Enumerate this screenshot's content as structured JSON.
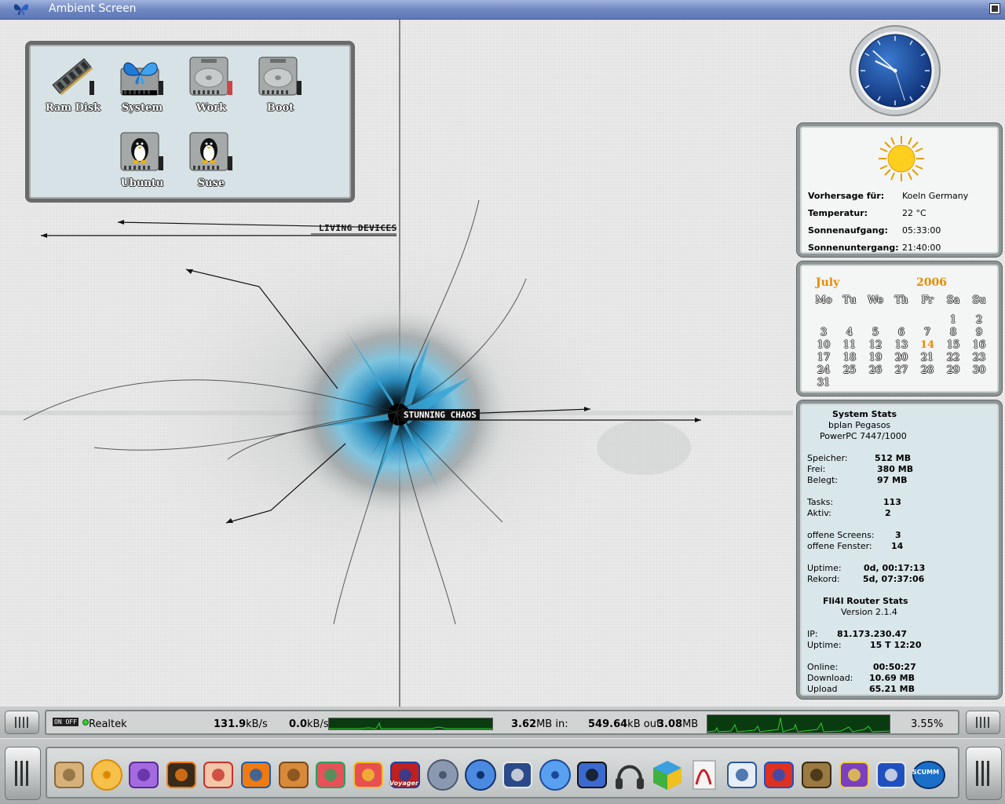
{
  "window": {
    "title": "Ambient Screen"
  },
  "drives": [
    {
      "label": "Ram Disk",
      "icon": "ram-disk-icon"
    },
    {
      "label": "System",
      "icon": "system-drive-icon"
    },
    {
      "label": "Work",
      "icon": "work-drive-icon"
    },
    {
      "label": "Boot",
      "icon": "boot-drive-icon"
    },
    {
      "label": "Ubuntu",
      "icon": "ubuntu-drive-icon"
    },
    {
      "label": "Suse",
      "icon": "suse-drive-icon"
    }
  ],
  "art": {
    "label_top": "LIVING DEVICES",
    "label_center": "STUNNING CHAOS"
  },
  "clock": {
    "hours": 9,
    "minutes": 52,
    "seconds": 27
  },
  "weather": {
    "icon": "sun-icon",
    "rows": [
      {
        "label": "Vorhersage für:",
        "value": "Koeln Germany"
      },
      {
        "label": "Temperatur:",
        "value": "22 °C"
      },
      {
        "label": "Sonnenaufgang:",
        "value": "05:33:00"
      },
      {
        "label": "Sonnenuntergang:",
        "value": "21:40:00"
      }
    ]
  },
  "calendar": {
    "month": "July",
    "year": "2006",
    "weekdays": [
      "Mo",
      "Tu",
      "We",
      "Th",
      "Fr",
      "Sa",
      "Su"
    ],
    "days": [
      "1",
      "2",
      "3",
      "4",
      "5",
      "6",
      "7",
      "8",
      "9",
      "10",
      "11",
      "12",
      "13",
      "14",
      "15",
      "16",
      "17",
      "18",
      "19",
      "20",
      "21",
      "22",
      "23",
      "24",
      "25",
      "26",
      "27",
      "28",
      "29",
      "30",
      "31"
    ],
    "today": "14"
  },
  "stats": {
    "header": [
      "System Stats",
      "bplan Pegasos",
      "PowerPC 7447/1000"
    ],
    "rows": [
      {
        "label": "Speicher:",
        "value": "512 MB"
      },
      {
        "label": "Frei:",
        "value": "380 MB"
      },
      {
        "label": "Belegt:",
        "value": "97 MB"
      },
      {
        "label": "Tasks:",
        "value": "113"
      },
      {
        "label": "Aktiv:",
        "value": "2"
      },
      {
        "label": "offene Screens:",
        "value": "3"
      },
      {
        "label": "offene Fenster:",
        "value": "14"
      },
      {
        "label": "Uptime:",
        "value": "0d, 00:17:13"
      },
      {
        "label": "Rekord:",
        "value": "5d, 07:37:06"
      }
    ],
    "router_header": [
      "Fli4l Router Stats",
      "Version 2.1.4"
    ],
    "router_rows": [
      {
        "label": "IP:",
        "value": "81.173.230.47"
      },
      {
        "label": "Uptime:",
        "value": "15 T 12:20"
      },
      {
        "label": "Online:",
        "value": "00:50:27"
      },
      {
        "label": "Download:",
        "value": "10.69 MB"
      },
      {
        "label": "Upload",
        "value": "65.21 MB"
      }
    ]
  },
  "netbar": {
    "toggle": "ON OFF",
    "interface": "Realtek",
    "down_value": "131.9",
    "down_unit": "kB/s",
    "up_value": "0.0",
    "up_unit": "kB/s",
    "total_value": "3.62",
    "total_unit": "MB in:",
    "in_value": "549.64",
    "in_unit": "kB out:",
    "out_value": "3.08",
    "out_unit": "MB",
    "cpu_value": "3.55%"
  },
  "dock": {
    "items": [
      "package-icon",
      "cd-icon",
      "mail-icon",
      "flame-icon",
      "pinup-icon",
      "blender-icon",
      "image-viewer-icon",
      "spiral-icon",
      "paint-icon",
      "voyager-browser-icon",
      "disk-utility-icon",
      "globe-icon",
      "eagle-icon",
      "spiral-blue-icon",
      "clapperboard-icon",
      "headphones-icon",
      "cube-icon",
      "pdf-icon",
      "draw-icon",
      "mario-icon",
      "snk-icon",
      "megaman-icon",
      "sonic-icon",
      "scumm-icon"
    ],
    "labels": {
      "voyager": "Voyager",
      "scumm": "SCUMM"
    }
  },
  "colors": {
    "titlebar": "#6f86c0",
    "accent_orange": "#e98a00",
    "graph_green": "#1fbf2a"
  }
}
